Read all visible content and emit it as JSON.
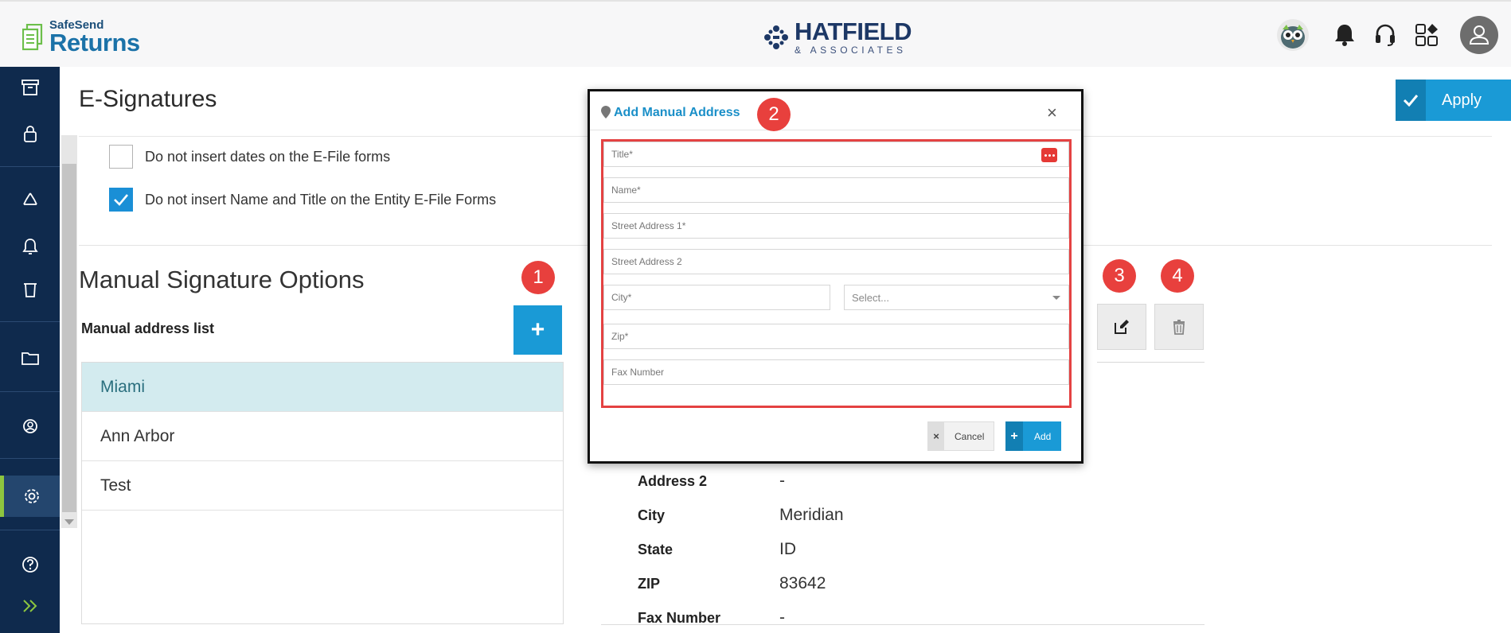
{
  "header": {
    "product_line1": "SafeSend",
    "product_line2": "Returns",
    "company_name": "HATFIELD",
    "company_sub": "& ASSOCIATES",
    "icons": [
      "owl-avatar-icon",
      "bell-icon",
      "headset-icon",
      "apps-grid-icon",
      "user-profile-icon"
    ]
  },
  "rail": {
    "icons": [
      "archive-icon",
      "lock-icon",
      "recycle-icon",
      "bell-icon",
      "trash-icon",
      "folder-icon",
      "user-settings-icon",
      "gear-icon",
      "help-icon",
      "expand-chevrons-icon"
    ],
    "active": "gear-icon",
    "active_color": "#8dc63f"
  },
  "page": {
    "title": "E-Signatures",
    "apply_label": "Apply"
  },
  "options": [
    {
      "label": "Do not insert dates on the E-File forms",
      "checked": false
    },
    {
      "label": "Do not insert Name and Title on the Entity E-File Forms",
      "checked": true
    }
  ],
  "manual": {
    "section_title": "Manual Signature Options",
    "list_label": "Manual address list",
    "add_symbol": "+",
    "items": [
      "Miami",
      "Ann Arbor",
      "Test"
    ],
    "selected": "Miami"
  },
  "badges": [
    "1",
    "2",
    "3",
    "4"
  ],
  "details": [
    {
      "key": "Address 2",
      "value": "-"
    },
    {
      "key": "City",
      "value": "Meridian"
    },
    {
      "key": "State",
      "value": "ID"
    },
    {
      "key": "ZIP",
      "value": "83642"
    },
    {
      "key": "Fax Number",
      "value": "-"
    }
  ],
  "modal": {
    "title": "Add Manual Address",
    "close": "×",
    "fields": {
      "title": "Title*",
      "name": "Name*",
      "street1": "Street Address 1*",
      "street2": "Street Address 2",
      "city": "City*",
      "state": "Select...",
      "zip": "Zip*",
      "fax": "Fax Number"
    },
    "cancel_label": "Cancel",
    "cancel_symbol": "×",
    "add_label": "Add",
    "add_symbol": "+"
  },
  "colors": {
    "accent": "#1a9ad6",
    "rail_bg": "#0f2a4d",
    "badge": "#e8403d",
    "selected_row": "#d3ebef"
  }
}
